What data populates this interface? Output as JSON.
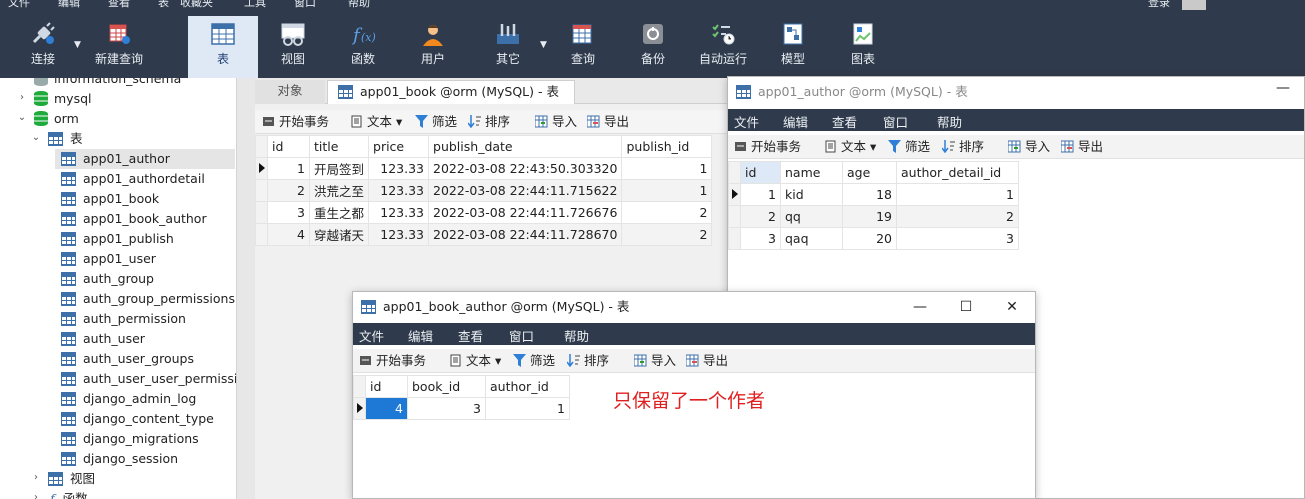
{
  "topmenu": {
    "items": [
      "文件",
      "编辑",
      "查看",
      "表",
      "收藏夹",
      "工具",
      "窗口",
      "帮助"
    ],
    "login": "登录"
  },
  "toolbar": {
    "buttons": [
      {
        "label": "连接",
        "icon": "plug-icon"
      },
      {
        "label": "新建查询",
        "icon": "new-query-icon"
      },
      {
        "label": "表",
        "icon": "table-icon"
      },
      {
        "label": "视图",
        "icon": "view-icon"
      },
      {
        "label": "函数",
        "icon": "function-icon"
      },
      {
        "label": "用户",
        "icon": "user-icon"
      },
      {
        "label": "其它",
        "icon": "tools-icon"
      },
      {
        "label": "查询",
        "icon": "query-icon"
      },
      {
        "label": "备份",
        "icon": "backup-icon"
      },
      {
        "label": "自动运行",
        "icon": "schedule-icon"
      },
      {
        "label": "模型",
        "icon": "model-icon"
      },
      {
        "label": "图表",
        "icon": "chart-icon"
      }
    ]
  },
  "tree": {
    "partial_top": "information_schema",
    "db_mysql": "mysql",
    "db_orm": "orm",
    "folder_tables": "表",
    "tables": [
      "app01_author",
      "app01_authordetail",
      "app01_book",
      "app01_book_author",
      "app01_publish",
      "app01_user",
      "auth_group",
      "auth_group_permissions",
      "auth_permission",
      "auth_user",
      "auth_user_groups",
      "auth_user_user_permissions",
      "django_admin_log",
      "django_content_type",
      "django_migrations",
      "django_session"
    ],
    "folder_views": "视图",
    "folder_functions": "函数"
  },
  "tabs": {
    "objects": "对象",
    "book": "app01_book @orm (MySQL) - 表"
  },
  "actions": {
    "begin": "开始事务",
    "text": "文本",
    "filter": "筛选",
    "sort": "排序",
    "import": "导入",
    "export": "导出"
  },
  "winmenu": [
    "文件",
    "编辑",
    "查看",
    "窗口",
    "帮助"
  ],
  "book_grid": {
    "columns": [
      "id",
      "title",
      "price",
      "publish_date",
      "publish_id"
    ],
    "rows": [
      [
        "1",
        "开局签到",
        "123.33",
        "2022-03-08 22:43:50.303320",
        "1"
      ],
      [
        "2",
        "洪荒之至",
        "123.33",
        "2022-03-08 22:44:11.715622",
        "1"
      ],
      [
        "3",
        "重生之都",
        "123.33",
        "2022-03-08 22:44:11.726676",
        "2"
      ],
      [
        "4",
        "穿越诸天",
        "123.33",
        "2022-03-08 22:44:11.728670",
        "2"
      ]
    ]
  },
  "author_window": {
    "title": "app01_author @orm (MySQL) - 表",
    "columns": [
      "id",
      "name",
      "age",
      "author_detail_id"
    ],
    "rows": [
      [
        "1",
        "kid",
        "18",
        "1"
      ],
      [
        "2",
        "qq",
        "19",
        "2"
      ],
      [
        "3",
        "qaq",
        "20",
        "3"
      ]
    ]
  },
  "book_author_window": {
    "title": "app01_book_author @orm (MySQL) - 表",
    "columns": [
      "id",
      "book_id",
      "author_id"
    ],
    "rows": [
      [
        "4",
        "3",
        "1"
      ]
    ]
  },
  "annotation": "只保留了一个作者",
  "colors": {
    "toolbar_bg": "#2f3b4c",
    "accent": "#3d6fa9",
    "annotation": "#e02020"
  }
}
